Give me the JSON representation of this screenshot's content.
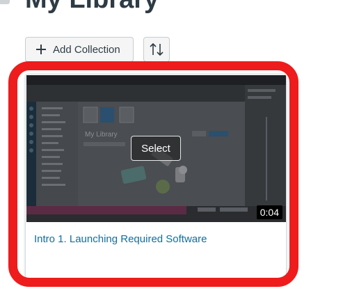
{
  "page": {
    "title": "My Library"
  },
  "toolbar": {
    "add_collection_label": "Add Collection",
    "add_icon": "plus-icon",
    "sort_icon": "sort-arrows-icon"
  },
  "card": {
    "action_label": "Select",
    "duration": "0:04",
    "title": "Intro 1. Launching Required Software"
  },
  "thumbnail": {
    "inner_title": "My Library"
  },
  "colors": {
    "highlight": "#ee1c1c",
    "link": "#0b6fa3",
    "heading": "#2d3b45"
  }
}
